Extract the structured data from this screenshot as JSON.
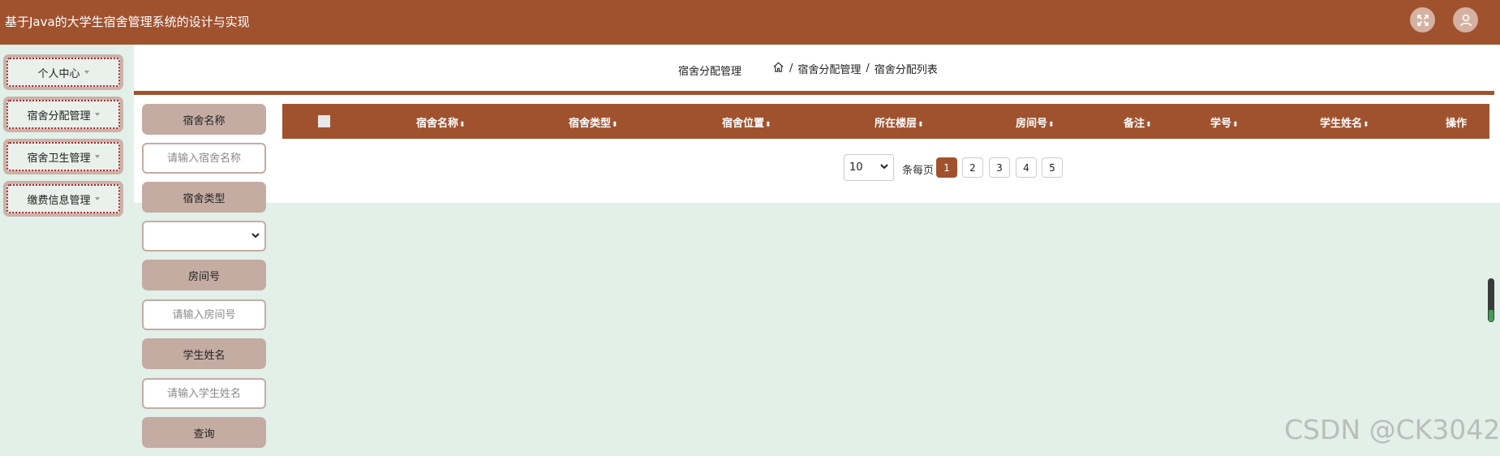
{
  "header": {
    "title": "基于Java的大学生宿舍管理系统的设计与实现",
    "fullscreen_icon": "expand-icon",
    "user_icon": "user-icon"
  },
  "sidebar": {
    "items": [
      {
        "label": "个人中心"
      },
      {
        "label": "宿舍分配管理"
      },
      {
        "label": "宿舍卫生管理"
      },
      {
        "label": "缴费信息管理"
      }
    ]
  },
  "breadcrumb": {
    "page_title": "宿舍分配管理",
    "home_icon": "home-icon",
    "separator": "/",
    "level1": "宿舍分配管理",
    "level2": "宿舍分配列表"
  },
  "search": {
    "dorm_name_label": "宿舍名称",
    "dorm_name_placeholder": "请输入宿舍名称",
    "dorm_type_label": "宿舍类型",
    "dorm_type_value": "",
    "room_no_label": "房间号",
    "room_no_placeholder": "请输入房间号",
    "student_name_label": "学生姓名",
    "student_name_placeholder": "请输入学生姓名",
    "query_label": "查询"
  },
  "table": {
    "columns": [
      "宿舍名称",
      "宿舍类型",
      "宿舍位置",
      "所在楼层",
      "房间号",
      "备注",
      "学号",
      "学生姓名",
      "操作"
    ],
    "sort_glyph": "⬍",
    "rows": []
  },
  "pagination": {
    "page_size": "10",
    "per_page_label": "条每页",
    "pages": [
      "1",
      "2",
      "3",
      "4",
      "5"
    ],
    "current_page": "1"
  },
  "watermark": "CSDN @CK3042",
  "colors": {
    "brand": "#a0522f",
    "label_bg": "#c5aca3",
    "page_bg": "#e3efe9"
  }
}
